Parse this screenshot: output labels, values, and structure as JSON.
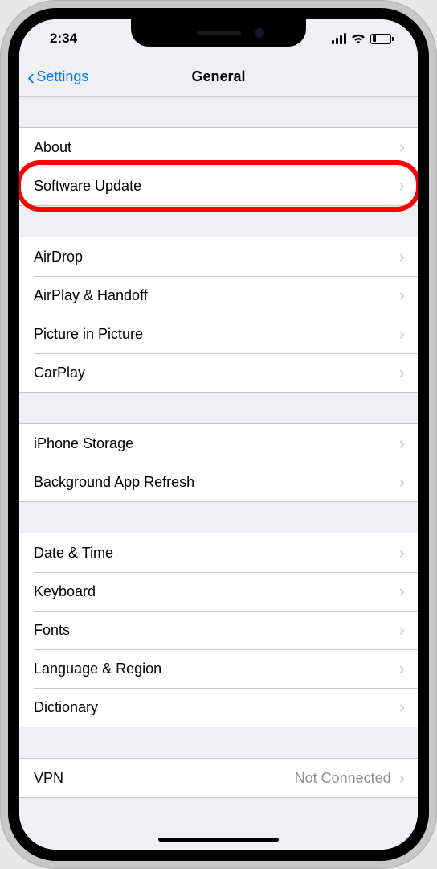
{
  "status": {
    "time": "2:34"
  },
  "nav": {
    "back_label": "Settings",
    "title": "General"
  },
  "groups": [
    {
      "items": [
        {
          "label": "About",
          "detail": ""
        },
        {
          "label": "Software Update",
          "detail": "",
          "highlighted": true
        }
      ]
    },
    {
      "items": [
        {
          "label": "AirDrop",
          "detail": ""
        },
        {
          "label": "AirPlay & Handoff",
          "detail": ""
        },
        {
          "label": "Picture in Picture",
          "detail": ""
        },
        {
          "label": "CarPlay",
          "detail": ""
        }
      ]
    },
    {
      "items": [
        {
          "label": "iPhone Storage",
          "detail": ""
        },
        {
          "label": "Background App Refresh",
          "detail": ""
        }
      ]
    },
    {
      "items": [
        {
          "label": "Date & Time",
          "detail": ""
        },
        {
          "label": "Keyboard",
          "detail": ""
        },
        {
          "label": "Fonts",
          "detail": ""
        },
        {
          "label": "Language & Region",
          "detail": ""
        },
        {
          "label": "Dictionary",
          "detail": ""
        }
      ]
    },
    {
      "items": [
        {
          "label": "VPN",
          "detail": "Not Connected"
        }
      ]
    }
  ]
}
